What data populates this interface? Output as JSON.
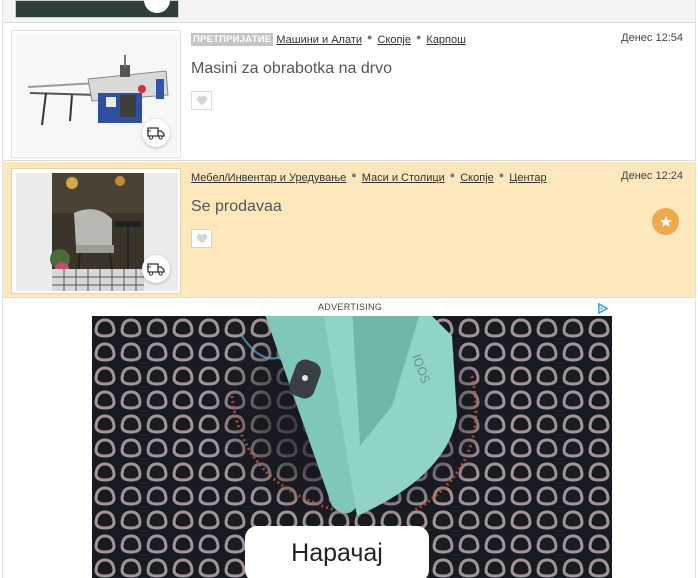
{
  "listings": [
    {
      "badge": "ПРЕТПРИЈАТИЕ",
      "category": "Машини и Алати",
      "city": "Скопје",
      "area": "Карпош",
      "time": "Денес 12:54",
      "title": "Masini za obrabotka na drvo"
    },
    {
      "category": "Мебел/Инвентар и Уредување",
      "subcategory": "Маси и Столици",
      "city": "Скопје",
      "area": "Центар",
      "time": "Денес 12:24",
      "title": "Se prodavaa"
    }
  ],
  "ad": {
    "label": "ADVERTISING",
    "brand": "IQOS",
    "cta": "Нарачај"
  },
  "colors": {
    "promoted_bg": "#fde7bd",
    "star_badge": "#f0a84c",
    "ad_device": "#8fd4c4"
  },
  "icons": [
    "delivery-truck-icon",
    "heart-icon",
    "star-icon",
    "ad-choices-icon"
  ]
}
